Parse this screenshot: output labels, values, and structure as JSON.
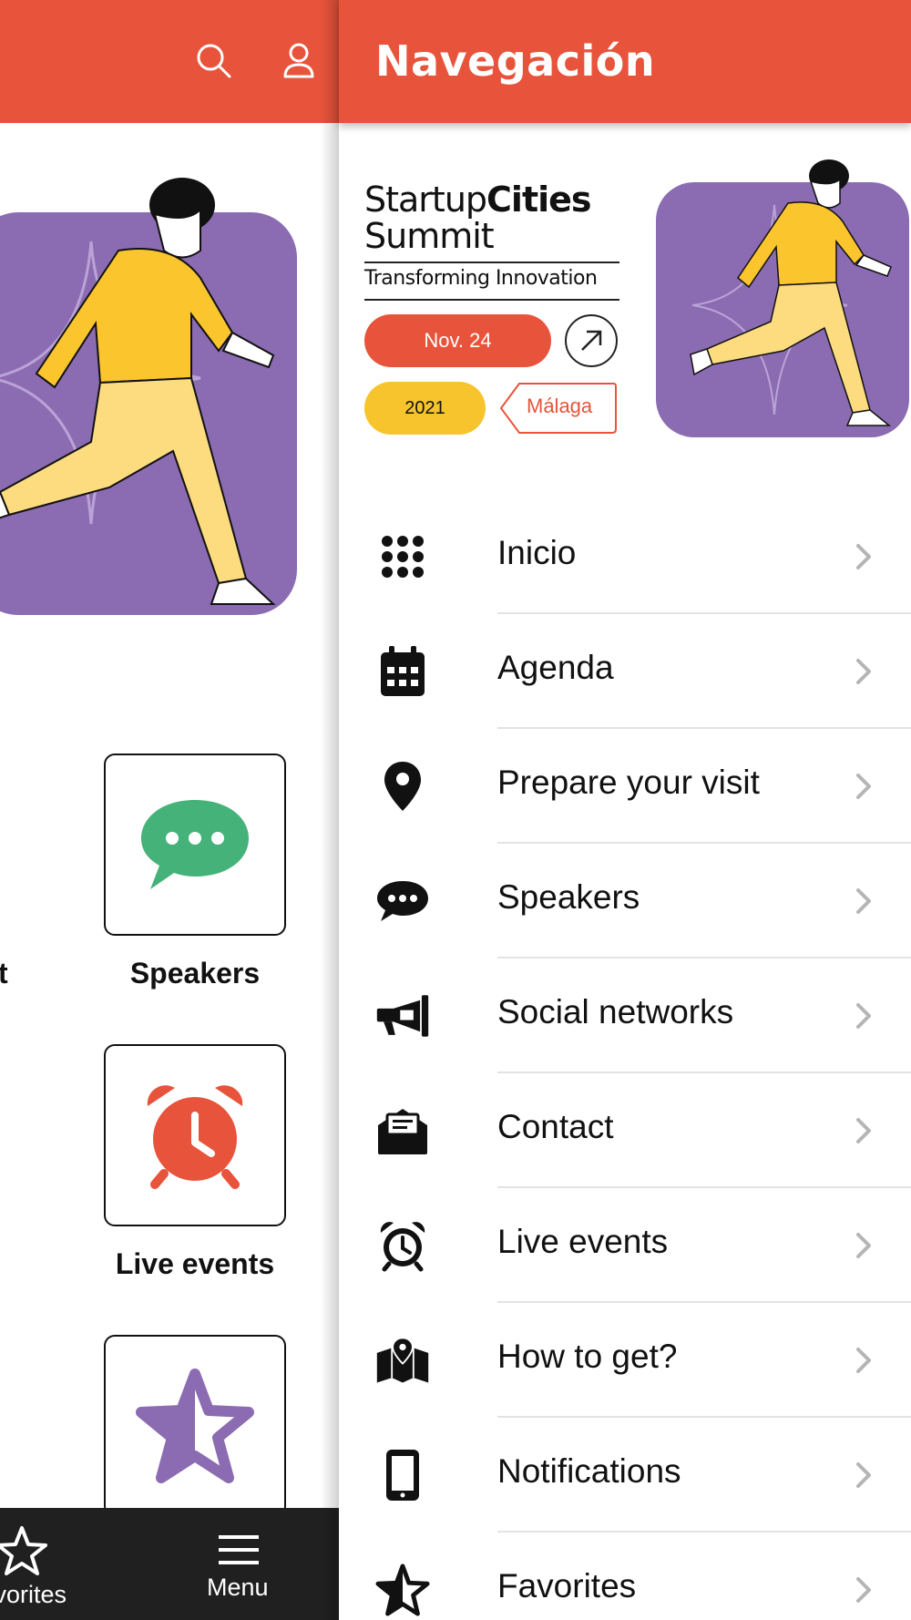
{
  "background_page": {
    "tiles": [
      {
        "label": "Speakers",
        "icon": "speech-bubble-icon",
        "color": "#45b27a"
      },
      {
        "label": "Live events",
        "icon": "alarm-clock-icon",
        "color": "#e8533b"
      },
      {
        "label": "",
        "icon": "half-star-icon",
        "color": "#8b6bb1"
      }
    ],
    "cut_label": "t",
    "bottom_bar": {
      "favorites_label": "Favorites",
      "menu_label": "Menu"
    }
  },
  "drawer": {
    "title": "Navegación",
    "logo": {
      "line1_regular": "Startup",
      "line1_bold": "Cities",
      "line2": "Summit",
      "tagline": "Transforming Innovation",
      "date": "Nov. 24",
      "year": "2021",
      "city": "Málaga"
    },
    "items": [
      {
        "label": "Inicio",
        "icon": "grid-dots-icon"
      },
      {
        "label": "Agenda",
        "icon": "calendar-icon"
      },
      {
        "label": "Prepare your visit",
        "icon": "map-pin-icon"
      },
      {
        "label": "Speakers",
        "icon": "speech-bubble-icon"
      },
      {
        "label": "Social networks",
        "icon": "megaphone-icon"
      },
      {
        "label": "Contact",
        "icon": "mail-envelope-icon"
      },
      {
        "label": "Live events",
        "icon": "alarm-clock-icon"
      },
      {
        "label": "How to get?",
        "icon": "map-location-icon"
      },
      {
        "label": "Notifications",
        "icon": "smartphone-icon"
      },
      {
        "label": "Favorites",
        "icon": "half-star-icon"
      }
    ]
  },
  "colors": {
    "brand_red": "#e8533b",
    "brand_purple": "#8b6bb1",
    "brand_yellow": "#f7c42e",
    "bar_dark": "#202020"
  }
}
